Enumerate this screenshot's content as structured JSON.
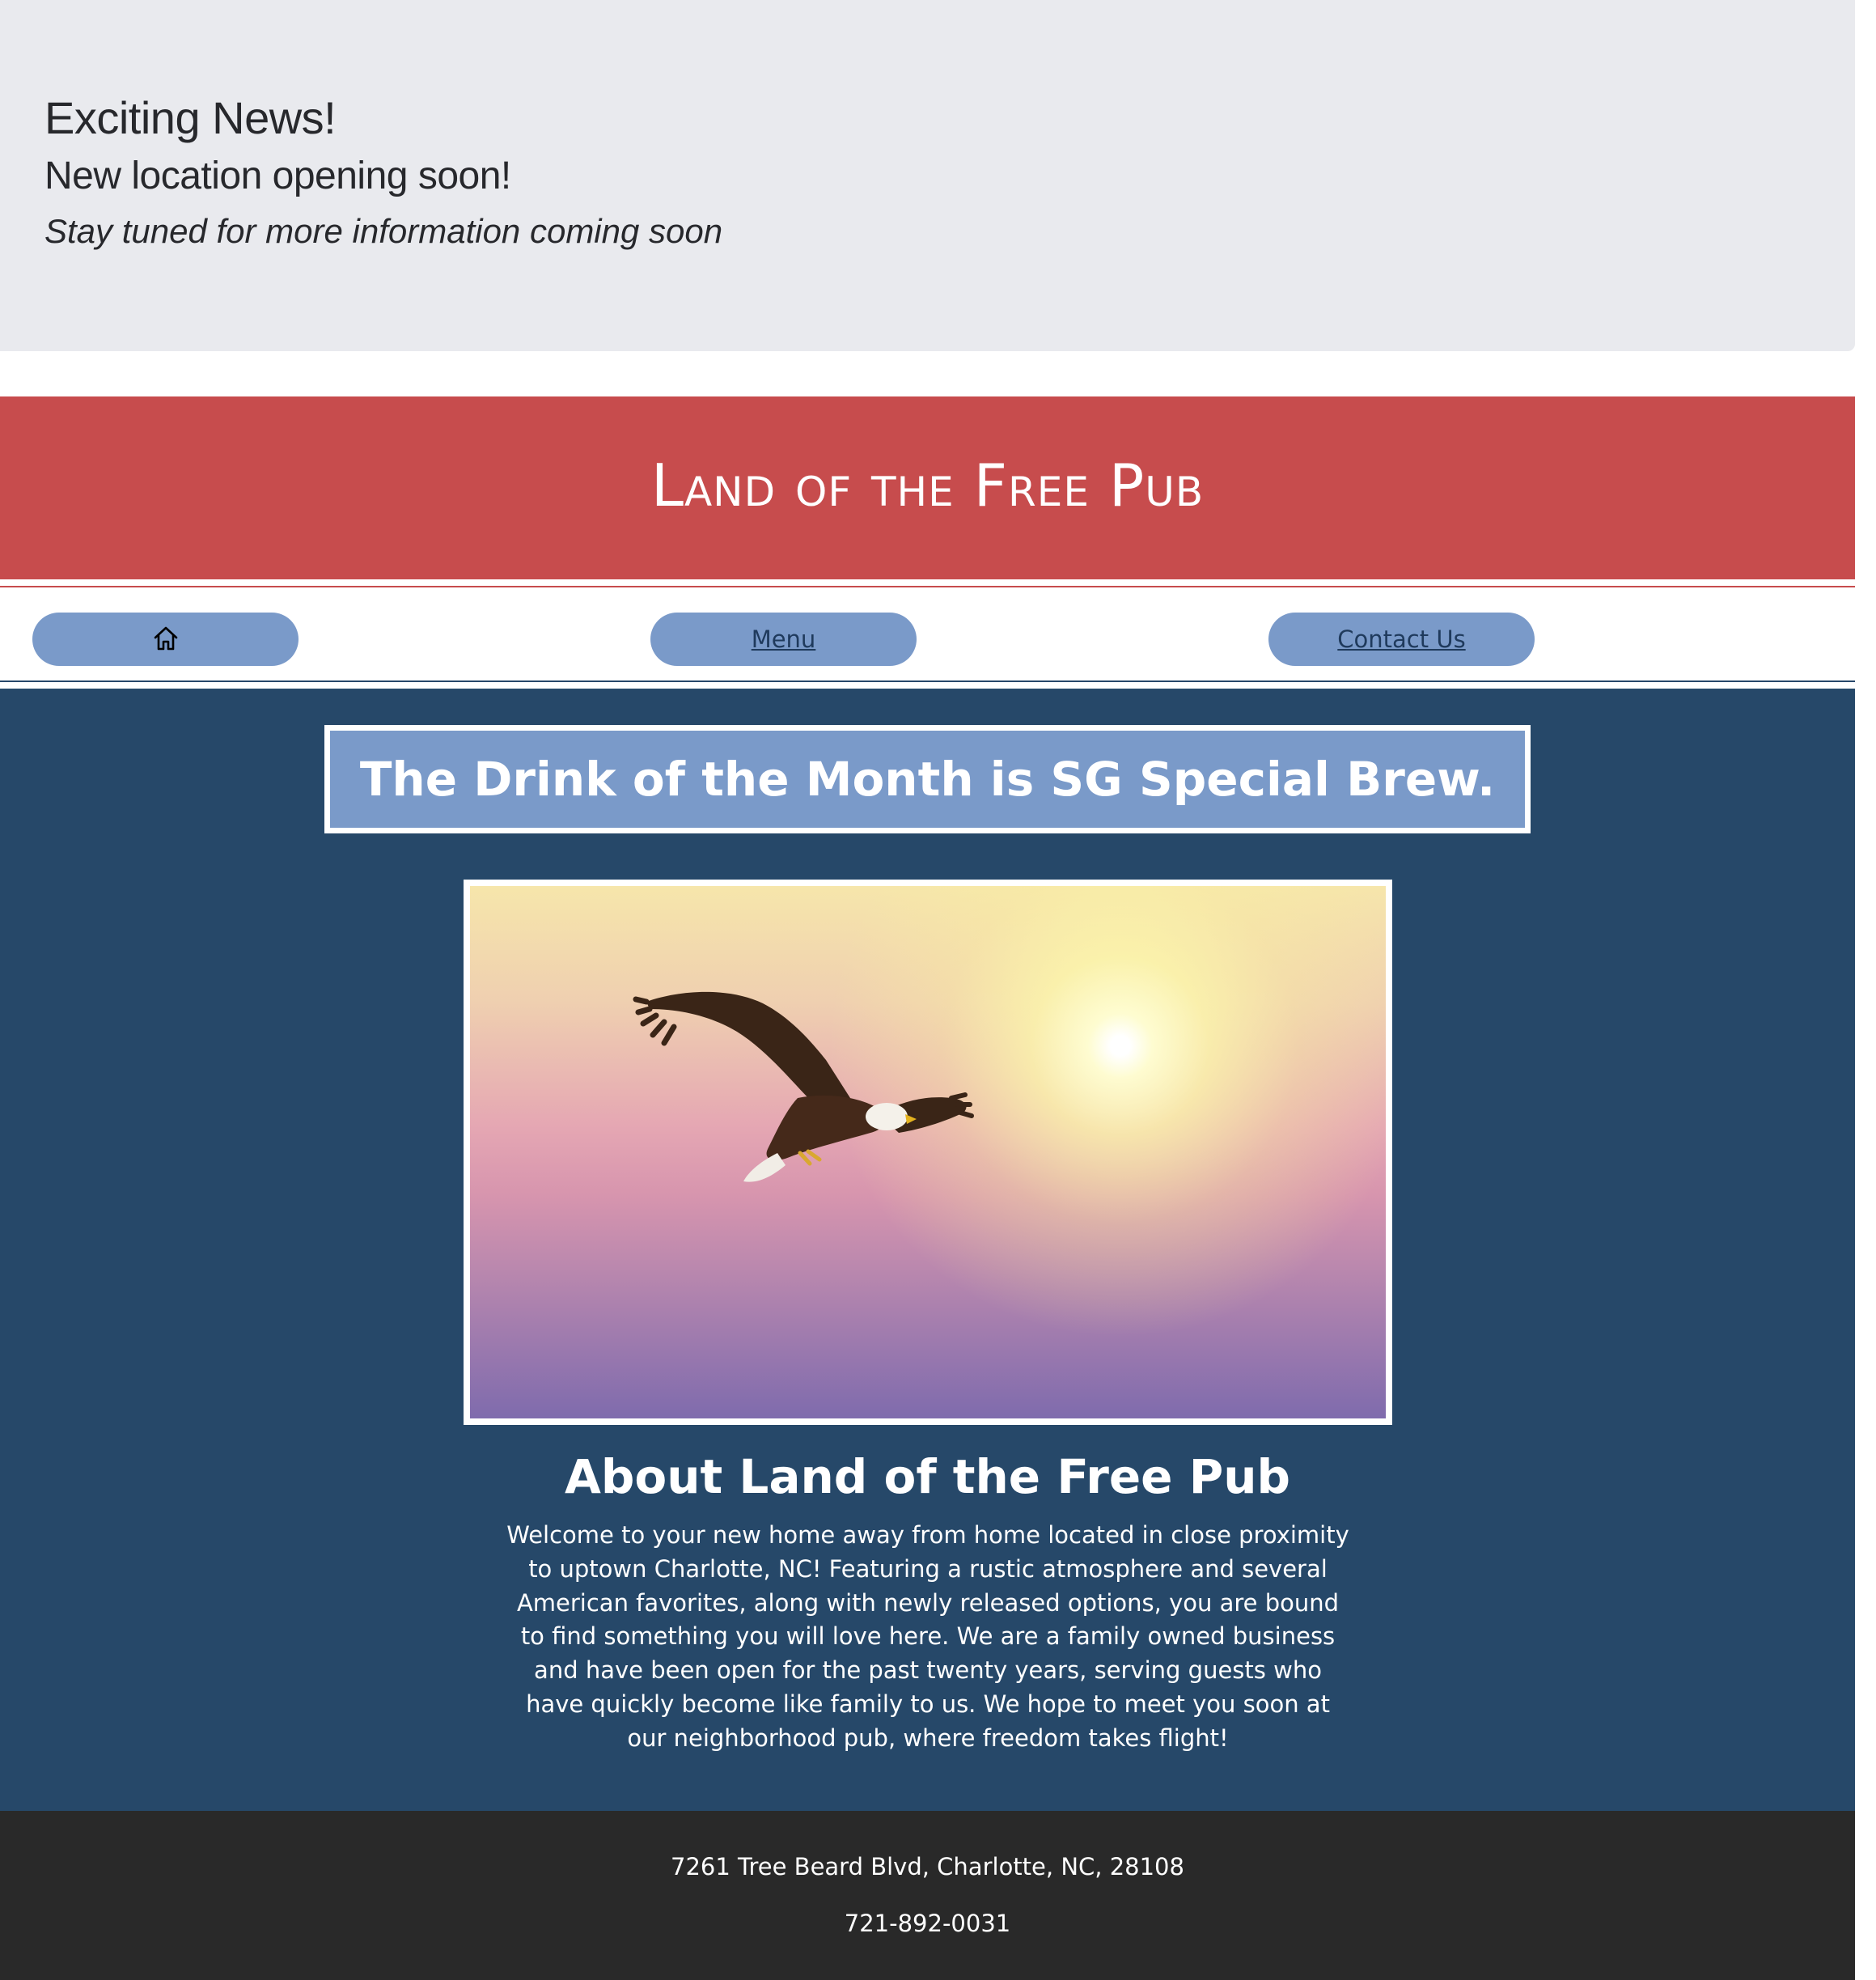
{
  "announcement": {
    "heading": "Exciting News!",
    "subheading": "New location opening soon!",
    "note": "Stay tuned for more information coming soon"
  },
  "header": {
    "title": "Land of the Free Pub"
  },
  "nav": {
    "home_icon": "home-icon",
    "menu_label": "Menu",
    "contact_label": "Contact Us"
  },
  "main": {
    "drink_of_month": "The Drink of the Month is SG Special Brew.",
    "image": "bald eagle flying toward sun",
    "about_title": "About Land of the Free Pub",
    "about_text": "Welcome to your new home away from home located in close proximity to uptown Charlotte, NC! Featuring a rustic atmosphere and several American favorites, along with newly released options, you are bound to find something you will love here. We are a family owned business and have been open for the past twenty years, serving guests who have quickly become like family to us. We hope to meet you soon at our neighborhood pub, where freedom takes flight!"
  },
  "footer": {
    "address": "7261 Tree Beard Blvd, Charlotte, NC, 28108",
    "phone": "721-892-0031"
  },
  "colors": {
    "announcement_bg": "#e9eaee",
    "header_red": "#c74c4d",
    "nav_button": "#7a9ac9",
    "main_navy": "#264869",
    "footer_bg": "#292929"
  }
}
